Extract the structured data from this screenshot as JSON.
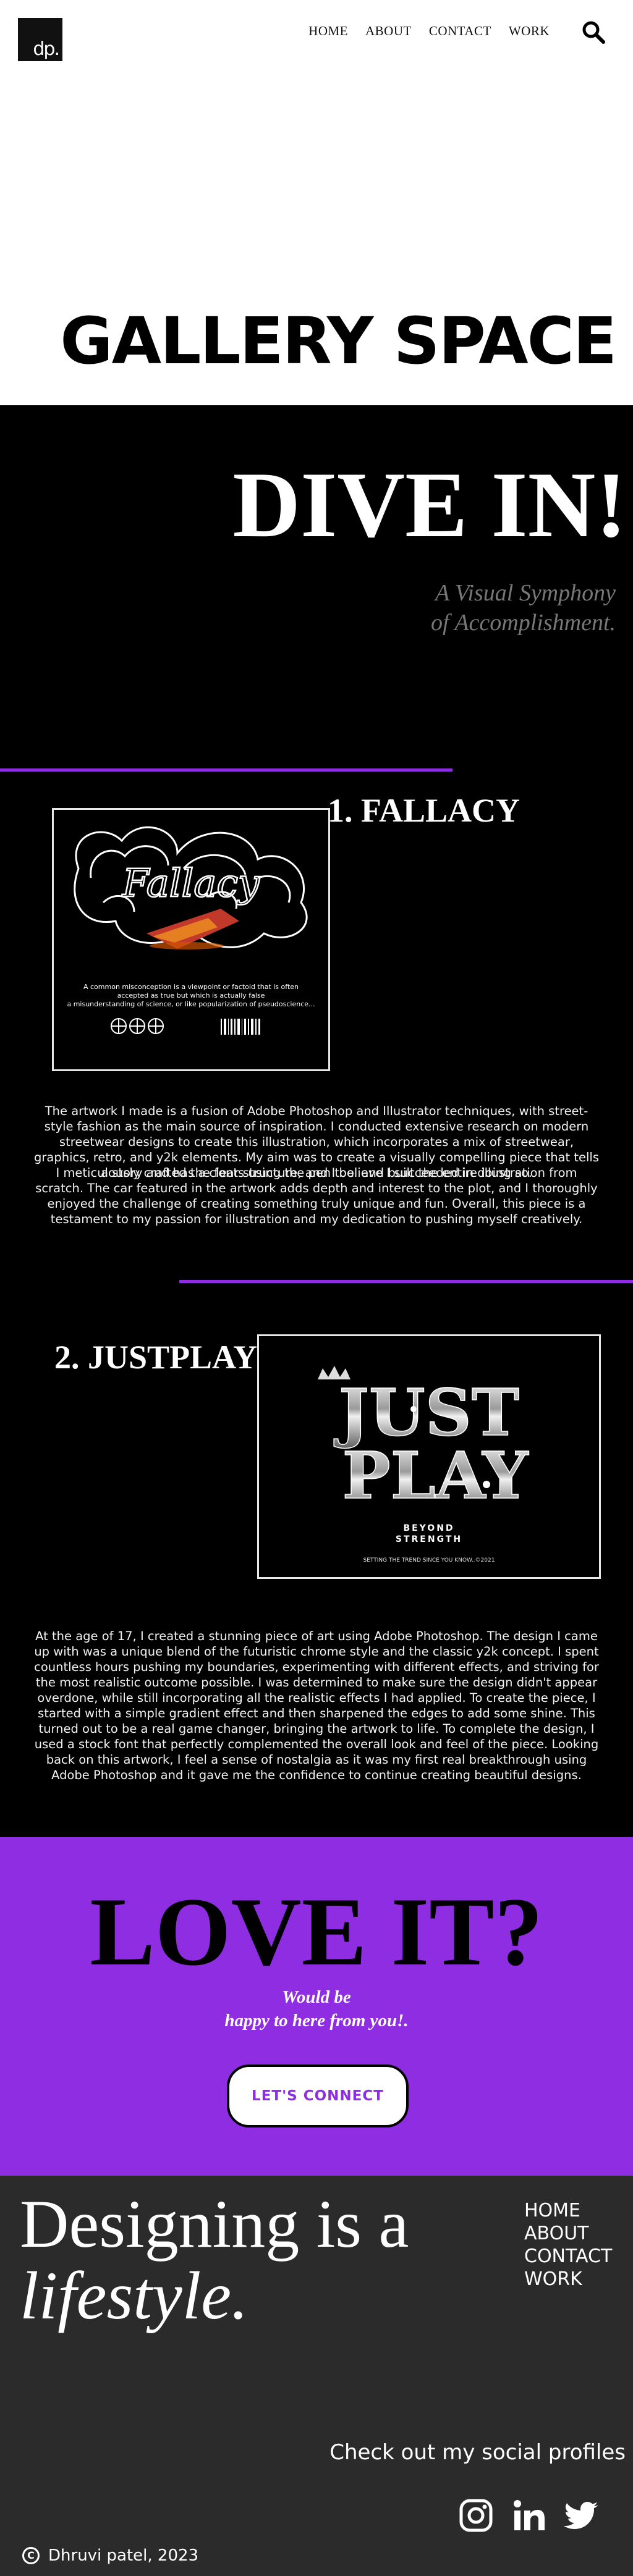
{
  "header": {
    "logo_text": "dp.",
    "nav": [
      "HOME",
      "ABOUT",
      "CONTACT",
      "WORK"
    ],
    "page_title": "GALLERY SPACE"
  },
  "intro": {
    "headline": "DIVE IN!",
    "tagline_line1": "A Visual Symphony",
    "tagline_line2": "of Accomplishment."
  },
  "works": [
    {
      "title": "1. FALLACY",
      "artwork_word": "Fallacy",
      "artwork_caption_lines": [
        "A common misconception is a viewpoint or factoid that is often",
        "accepted as true but which is actually false",
        "a misunderstanding of science, or like popularization of pseudoscience..."
      ],
      "paragraphs": [
        "The artwork I made is a fusion of Adobe Photoshop and Illustrator techniques, with street-style fashion as the main source of inspiration. I conducted extensive research on modern streetwear designs to create this illustration, which incorporates a mix of streetwear, graphics, retro, and y2k elements. My aim was to create a visually compelling piece that tells a story and has a clear structure, and I believe I succeeded in doing so.",
        "I meticulously crafted the fonts using the pen tool and built the entire illustration from scratch. The car featured in the artwork adds depth and interest to the plot, and I thoroughly enjoyed the challenge of creating something truly unique and fun. Overall, this piece is a testament to my passion for illustration and my dedication to pushing myself creatively."
      ]
    },
    {
      "title": "2. JUSTPLAY",
      "artwork_word_line1": "JUST",
      "artwork_word_line2": "PLAY",
      "artwork_sub1": "BEYOND",
      "artwork_sub2": "STRENGTH",
      "artwork_footer": "SETTING THE TREND SINCE YOU KNOW..©2021",
      "paragraphs": [
        "At the age of 17, I created a stunning piece of art using Adobe Photoshop. The design I came up with was a unique blend of the futuristic chrome style and the classic y2k concept. I spent countless hours pushing my boundaries, experimenting with different effects, and striving for the most realistic outcome possible. I was determined to make sure the design didn't appear overdone, while still incorporating all the realistic effects I had applied. To create the piece, I started with a simple gradient effect and then sharpened the edges to add some shine. This turned out to be a real game changer, bringing the artwork to life. To complete the design, I used a stock font that perfectly complemented the overall look and feel of the piece. Looking back on this artwork, I feel a sense of nostalgia as it was my first real breakthrough using Adobe Photoshop and it gave me the confidence to continue creating beautiful designs."
      ]
    }
  ],
  "cta": {
    "headline": "LOVE IT?",
    "sub_line1": "Would be",
    "sub_line2": "happy to here from you!.",
    "button_label": "LET'S CONNECT"
  },
  "footer": {
    "motto_line1": "Designing is a",
    "motto_line2": "lifestyle.",
    "nav": [
      "HOME",
      "ABOUT",
      "CONTACT",
      "WORK"
    ],
    "social_text": "Check out my social profiles",
    "social_icons": [
      "instagram-icon",
      "linkedin-icon",
      "twitter-icon"
    ],
    "copyright_symbol": "C",
    "copyright": "Dhruvi patel, 2023"
  },
  "colors": {
    "accent": "#8e2de2",
    "dark_bg": "#000000",
    "footer_bg": "#2b2b2b",
    "tagline": "#777777"
  }
}
